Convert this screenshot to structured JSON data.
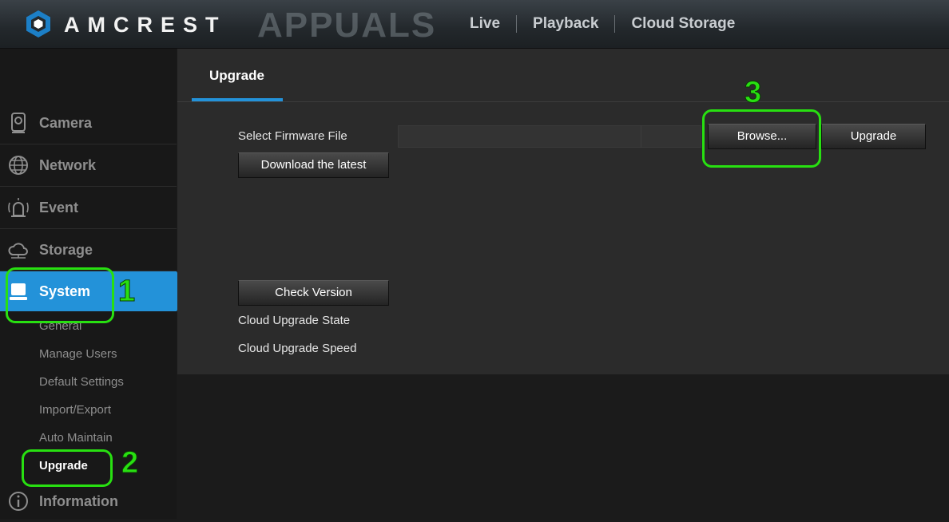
{
  "header": {
    "brand": "AMCREST",
    "watermark": "APPUALS",
    "nav": [
      {
        "label": "Live",
        "icon": "none"
      },
      {
        "label": "Playback",
        "icon": "none"
      },
      {
        "label": "Cloud Storage",
        "icon": "none"
      }
    ],
    "logo_icon": "amcrest-hexagon-logo"
  },
  "sidebar": {
    "menu": [
      {
        "label": "Camera",
        "icon": "camera-icon"
      },
      {
        "label": "Network",
        "icon": "globe-icon"
      },
      {
        "label": "Event",
        "icon": "alarm-icon"
      },
      {
        "label": "Storage",
        "icon": "cloud-icon"
      },
      {
        "label": "System",
        "icon": "monitor-icon",
        "active": true
      },
      {
        "label": "Information",
        "icon": "info-icon"
      }
    ],
    "submenu": [
      {
        "label": "General"
      },
      {
        "label": "Manage Users"
      },
      {
        "label": "Default Settings"
      },
      {
        "label": "Import/Export"
      },
      {
        "label": "Auto Maintain"
      },
      {
        "label": "Upgrade",
        "selected": true
      }
    ]
  },
  "main": {
    "tab_label": "Upgrade",
    "select_firmware_label": "Select Firmware File",
    "firmware_file_value": "",
    "browse_label": "Browse...",
    "upgrade_label": "Upgrade",
    "download_latest_label": "Download the latest",
    "check_version_label": "Check Version",
    "cloud_upgrade_state_label": "Cloud Upgrade State",
    "cloud_upgrade_speed_label": "Cloud Upgrade Speed"
  },
  "annotations": {
    "step1": "1",
    "step2": "2",
    "step3": "3",
    "color": "#28e011"
  },
  "colors": {
    "accent": "#2392d9",
    "panel": "#2b2b2b",
    "sidebar": "#181818"
  }
}
